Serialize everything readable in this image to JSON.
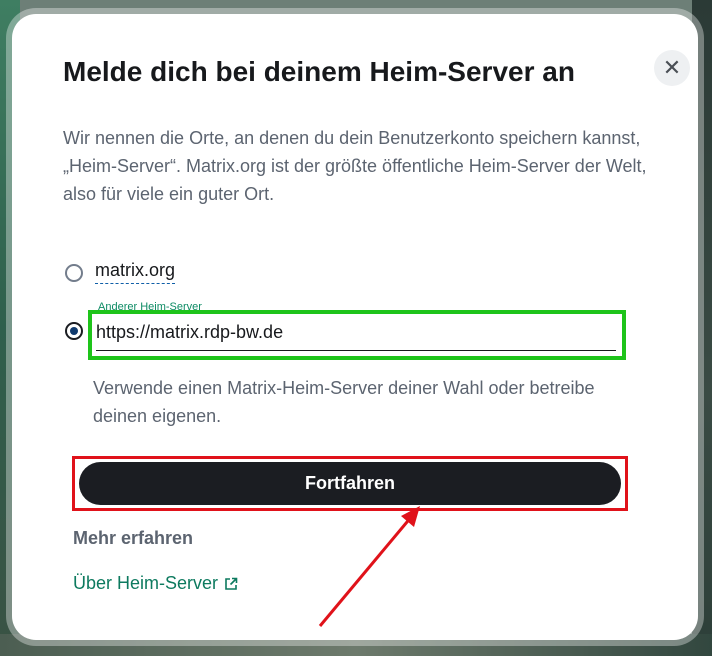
{
  "dialog": {
    "close_icon": "close-icon",
    "title": "Melde dich bei deinem Heim-Server an",
    "description": "Wir nennen die Orte, an denen du dein Benutzerkonto speichern kannst, „Heim-Server“. Matrix.org ist der größte öffentliche Heim-Server der Welt, also für viele ein guter Ort."
  },
  "options": {
    "matrix_org_label": "matrix.org",
    "matrix_org_selected": false,
    "other_selected": true,
    "other_field_label": "Anderer Heim-Server",
    "other_value": "https://matrix.rdp-bw.de",
    "hint": "Verwende einen Matrix-Heim-Server deiner Wahl oder betreibe deinen eigenen."
  },
  "continue_label": "Fortfahren",
  "more": {
    "title": "Mehr erfahren",
    "link_label": "Über Heim-Server",
    "link_icon": "external-link-icon"
  },
  "colors": {
    "highlight_green": "#1ec41a",
    "highlight_red": "#e0121a",
    "link": "#0d7a5f",
    "button_bg": "#1b1d22"
  }
}
